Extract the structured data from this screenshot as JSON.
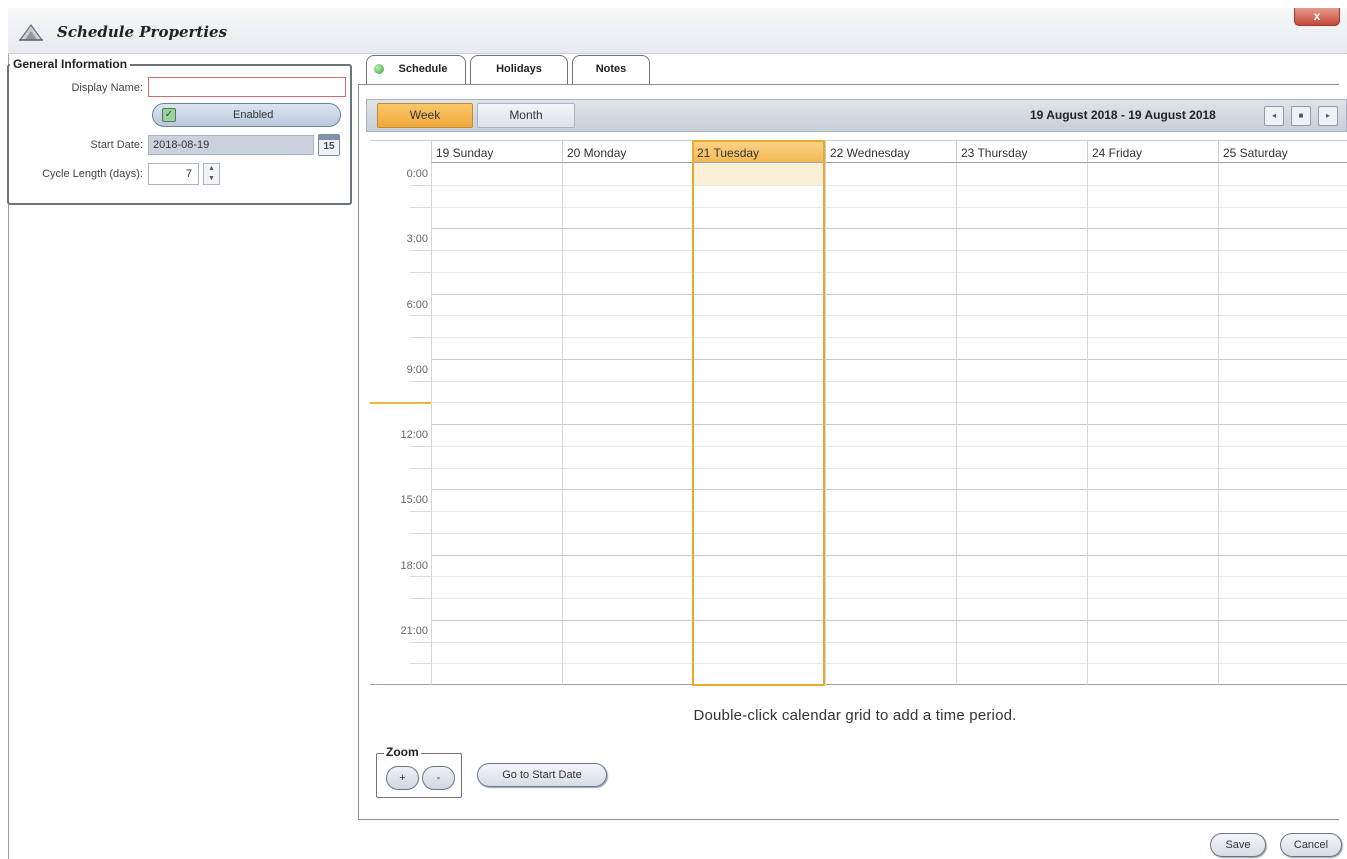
{
  "window": {
    "title": "Schedule Properties",
    "close_glyph": "x",
    "icon": "app-logo-icon"
  },
  "general_info": {
    "legend": "General Information",
    "display_name_label": "Display Name:",
    "display_name_value": "",
    "enabled_label": "Enabled",
    "enabled_checked": true,
    "start_date_label": "Start Date:",
    "start_date_value": "2018-08-19",
    "calendar_icon_number": "15",
    "cycle_length_label": "Cycle Length (days):",
    "cycle_length_value": "7"
  },
  "tabs": [
    {
      "label": "Schedule",
      "active": true
    },
    {
      "label": "Holidays",
      "active": false
    },
    {
      "label": "Notes",
      "active": false
    }
  ],
  "calendar": {
    "view_buttons": {
      "week": "Week",
      "month": "Month",
      "selected": "Week"
    },
    "range_label": "19 August 2018 - 19 August 2018",
    "nav": {
      "prev": "◂",
      "today": "■",
      "next": "▸"
    },
    "days": [
      {
        "label": "19 Sunday",
        "today": false
      },
      {
        "label": "20 Monday",
        "today": false
      },
      {
        "label": "21 Tuesday",
        "today": true
      },
      {
        "label": "22 Wednesday",
        "today": false
      },
      {
        "label": "23 Thursday",
        "today": false
      },
      {
        "label": "24 Friday",
        "today": false
      },
      {
        "label": "25 Saturday",
        "today": false
      }
    ],
    "times": [
      "0:00",
      "3:00",
      "6:00",
      "9:00",
      "12:00",
      "15:00",
      "18:00",
      "21:00"
    ],
    "hint": "Double-click calendar grid to add a time period.",
    "accent_color": "#f2a93b"
  },
  "zoom": {
    "legend": "Zoom",
    "in_label": "+",
    "out_label": "-"
  },
  "go_to_start_label": "Go to Start Date",
  "footer": {
    "save_label": "Save",
    "cancel_label": "Cancel"
  }
}
